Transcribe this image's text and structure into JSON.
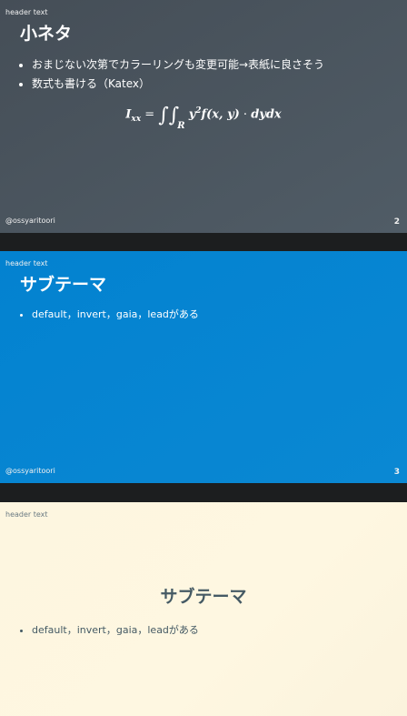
{
  "slides": [
    {
      "header": "header text",
      "title": "小ネタ",
      "bullets": [
        "おまじない次第でカラーリングも変更可能→表紙に良さそう",
        "数式も書ける（Katex）"
      ],
      "formula": {
        "lhs": "I",
        "lhs_sub": "xx",
        "equals": "=",
        "integral": "∫∫",
        "region": "R",
        "y_var": "y",
        "y_exp": "2",
        "fxy": "f(x, y)",
        "dot": "·",
        "diff": "dydx"
      },
      "footer": "@ossyaritoori",
      "page_number": "2",
      "theme_color": "#4b5660"
    },
    {
      "header": "header text",
      "title": "サブテーマ",
      "bullets": [
        "default，invert，gaia，leadがある"
      ],
      "footer": "@ossyaritoori",
      "page_number": "3",
      "theme_color": "#0685d1"
    },
    {
      "header": "header text",
      "title": "サブテーマ",
      "bullets": [
        "default，invert，gaia，leadがある"
      ],
      "theme_color": "#fdf6e0"
    }
  ]
}
